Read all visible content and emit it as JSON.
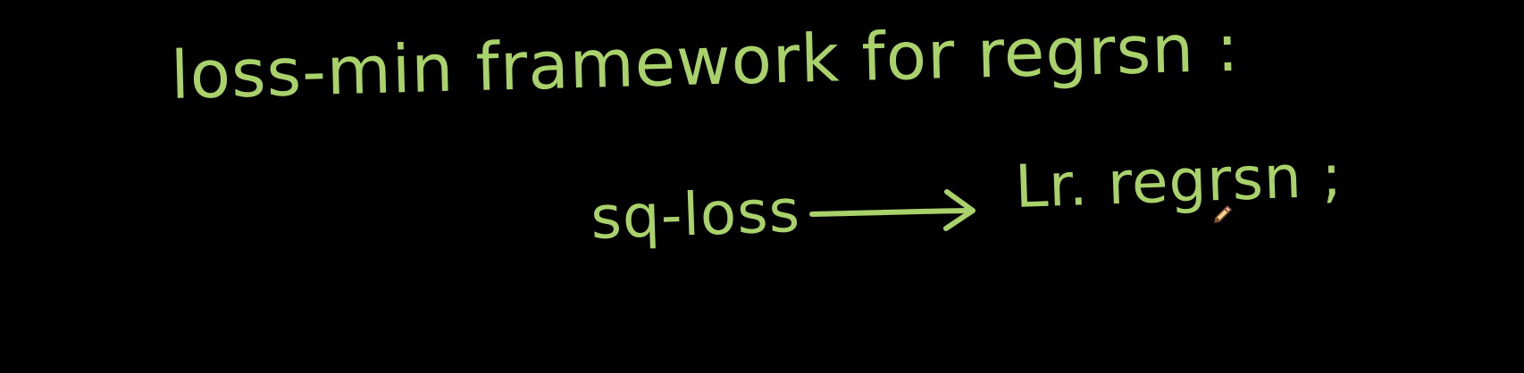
{
  "whiteboard": {
    "line_1": "loss-min framework for regrsn :",
    "line_2_left": "sq-loss",
    "line_2_right": "Lr. regrsn ;"
  },
  "icons": {
    "arrow": "right-arrow-icon",
    "cursor": "pencil-cursor-icon"
  },
  "colors": {
    "background": "#000000",
    "ink": "#a9d36a",
    "cursor_tip": "#7b4a2c"
  }
}
